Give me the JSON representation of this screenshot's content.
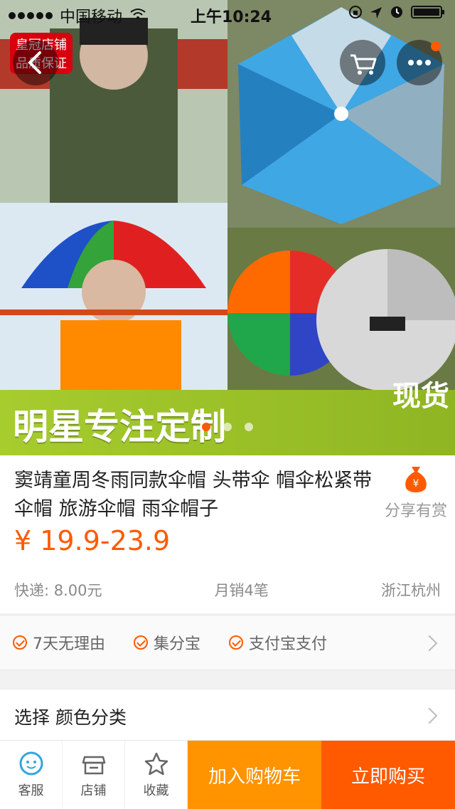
{
  "status": {
    "carrier": "中国移动",
    "time": "上午10:24"
  },
  "store_badge": {
    "line1": "皇冠店铺",
    "line2": "品质保证"
  },
  "hero": {
    "banner_text": "明星专注定制",
    "tag": "现货",
    "pager_index": 0,
    "pager_count": 3
  },
  "product": {
    "title": "窦靖童周冬雨同款伞帽 头带伞 帽伞松紧带伞帽 旅游伞帽 雨伞帽子",
    "share_label": "分享有赏",
    "price": "¥ 19.9-23.9",
    "shipping": "快递: 8.00元",
    "monthly_sales": "月销4笔",
    "location": "浙江杭州"
  },
  "guarantees": [
    "7天无理由",
    "集分宝",
    "支付宝支付"
  ],
  "select_row": {
    "label": "选择  颜色分类"
  },
  "footer": {
    "service": "客服",
    "store": "店铺",
    "favorite": "收藏",
    "add_to_cart": "加入购物车",
    "buy_now": "立即购买"
  },
  "colors": {
    "accent": "#ff5a00",
    "cart_button": "#ff9300"
  }
}
